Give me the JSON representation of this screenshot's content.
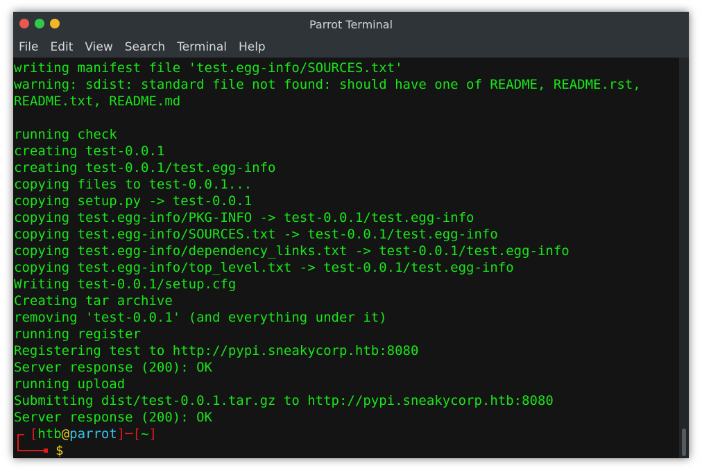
{
  "window": {
    "title": "Parrot Terminal"
  },
  "menu": [
    "File",
    "Edit",
    "View",
    "Search",
    "Terminal",
    "Help"
  ],
  "terminal": {
    "lines": [
      "writing manifest file 'test.egg-info/SOURCES.txt'",
      "warning: sdist: standard file not found: should have one of README, README.rst,",
      "README.txt, README.md",
      "",
      "running check",
      "creating test-0.0.1",
      "creating test-0.0.1/test.egg-info",
      "copying files to test-0.0.1...",
      "copying setup.py -> test-0.0.1",
      "copying test.egg-info/PKG-INFO -> test-0.0.1/test.egg-info",
      "copying test.egg-info/SOURCES.txt -> test-0.0.1/test.egg-info",
      "copying test.egg-info/dependency_links.txt -> test-0.0.1/test.egg-info",
      "copying test.egg-info/top_level.txt -> test-0.0.1/test.egg-info",
      "Writing test-0.0.1/setup.cfg",
      "Creating tar archive",
      "removing 'test-0.0.1' (and everything under it)",
      "running register",
      "Registering test to http://pypi.sneakycorp.htb:8080",
      "Server response (200): OK",
      "running upload",
      "Submitting dist/test-0.0.1.tar.gz to http://pypi.sneakycorp.htb:8080",
      "Server response (200): OK"
    ],
    "prompt": {
      "open_bracket": "[",
      "user": "htb",
      "at": "@",
      "host": "parrot",
      "close_bracket": "]",
      "dash": "─",
      "dir_open": "[",
      "dir": "~",
      "dir_close": "]",
      "symbol": "$"
    }
  },
  "colors": {
    "output": "#19e619",
    "prompt_frame": "#e01b1b",
    "prompt_at": "#f4d21c",
    "prompt_host": "#35c5e8",
    "background": "#141414"
  }
}
